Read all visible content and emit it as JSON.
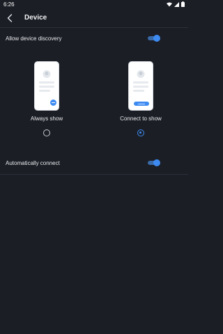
{
  "status_bar": {
    "time": "6:26",
    "icons": [
      "wifi-icon",
      "signal-icon",
      "battery-icon"
    ]
  },
  "header": {
    "back_icon": "back-chevron-icon",
    "title": "Device"
  },
  "settings": {
    "discovery": {
      "label": "Allow device discovery",
      "enabled": true
    },
    "modes": [
      {
        "label": "Always show",
        "selected": false,
        "illustration": "phone-with-fab"
      },
      {
        "label": "Connect to show",
        "selected": true,
        "illustration": "phone-with-button"
      }
    ],
    "auto_connect": {
      "label": "Automatically connect",
      "enabled": true
    }
  },
  "colors": {
    "background": "#1b1e25",
    "accent": "#3d8bf2",
    "divider": "#2c3039",
    "text": "#e8eaed"
  }
}
